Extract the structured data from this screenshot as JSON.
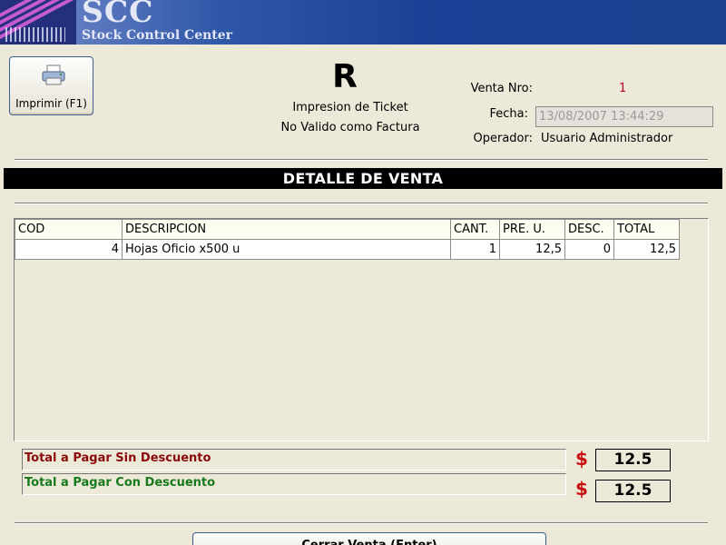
{
  "banner": {
    "title": "SCC",
    "subtitle": "Stock Control Center"
  },
  "toolbar": {
    "print_label": "Imprimir (F1)",
    "print_icon": "printer-icon"
  },
  "ticket": {
    "letter": "R",
    "line1": "Impresion de Ticket",
    "line2": "No Valido como Factura"
  },
  "info": {
    "venta_label": "Venta Nro:",
    "venta_value": "1",
    "fecha_label": "Fecha:",
    "fecha_value": "13/08/2007 13:44:29",
    "operador_label": "Operador:",
    "operador_value": "Usuario Administrador"
  },
  "section_title": "DETALLE DE VENTA",
  "grid": {
    "columns": [
      "COD",
      "DESCRIPCION",
      "CANT.",
      "PRE. U.",
      "DESC.",
      "TOTAL"
    ],
    "rows": [
      {
        "cod": "4",
        "descripcion": "Hojas Oficio x500 u",
        "cant": "1",
        "pre_u": "12,5",
        "desc": "0",
        "total": "12,5"
      }
    ]
  },
  "totals": {
    "sin_label": "Total a Pagar Sin Descuento",
    "sin_value": "12.5",
    "con_label": "Total a Pagar Con Descuento",
    "con_value": "12.5",
    "currency": "$"
  },
  "footer": {
    "close_label": "Cerrar Venta (Enter)"
  },
  "colors": {
    "venta_number": "#c0001c",
    "sin_label": "#8b0a0a",
    "con_label": "#177a1c",
    "currency": "#c81010"
  }
}
